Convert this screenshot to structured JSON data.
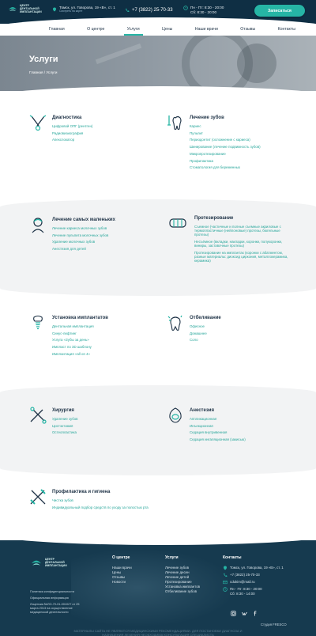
{
  "header": {
    "logo_lines": [
      "ЦЕНТР",
      "ДЕНТАЛЬНОЙ",
      "ИМПЛАНТАЦИИ"
    ],
    "address": "Томск, ул. Говорова, 19 «В», ст. 1",
    "address_link": "Смотреть на карте",
    "phone": "+7 (3822) 25-70-33",
    "hours_weekdays": "Пн - Пт: 8:30 - 20:00",
    "hours_saturday": "Сб: 8:30 - 20:00",
    "signup_label": "Записаться"
  },
  "nav": [
    "Главная",
    "О центре",
    "Услуги",
    "Цены",
    "Наши врачи",
    "Отзывы",
    "Контакты"
  ],
  "hero": {
    "title": "Услуги",
    "breadcrumb": "Главная / Услуги"
  },
  "categories": [
    {
      "title": "Диагностика",
      "icon": "dental-tools-icon",
      "items": [
        "Цифровой ОПГ (рентген)",
        "Радиовизиография",
        "Апекслокатор"
      ]
    },
    {
      "title": "Лечение зубов",
      "icon": "tooth-drill-icon",
      "items": [
        "Кариес",
        "Пульпит",
        "Периодонтит (осложнение с кариеса)",
        "Шинирование (лечение подвижность зубов)",
        "Микропротезирование",
        "Профилактика",
        "Стоматология для беременных"
      ]
    },
    {
      "title": "Лечение самых маленьких",
      "icon": "child-icon",
      "items": [
        "Лечение кариеса молочных зубов",
        "Лечение пульпита молочных зубов",
        "Удаление молочных зубов",
        "Анестезия для детей"
      ]
    },
    {
      "title": "Протезирование",
      "icon": "dentures-icon",
      "items": [
        "Съемное (частичные и полные съемные акриловые с термопластичные (нейлоновые) протезы, бюгельные протезы)",
        "Несъёмное (вкладки, накладки, коронки, полукоронки, виниры, заставочные протезы)",
        "Протезирование на имплантах (коронки с абатментом, разные материалы: диоксид циркония, металлокерамика, керамика)"
      ]
    },
    {
      "title": "Установка имплантатов",
      "icon": "implant-icon",
      "items": [
        "Дентальная имплантация",
        "Синус-лифтинг",
        "Услуга «Зубы за день»",
        "Импласт по 3D шаблону",
        "Имплантация «all on 4»"
      ]
    },
    {
      "title": "Отбеливание",
      "icon": "whitening-tooth-icon",
      "items": [
        "Офисное",
        "Домашнее",
        "Соло"
      ]
    },
    {
      "title": "Хирургия",
      "icon": "surgery-tools-icon",
      "items": [
        "Удаление зубов",
        "Цистэктомия",
        "Остеопластика"
      ]
    },
    {
      "title": "Анестезия",
      "icon": "anesthesia-mask-icon",
      "items": [
        "Аппликационная",
        "Инъекционная",
        "Седация внутривенная",
        "Седация ингаляционная (закисью)"
      ]
    },
    {
      "title": "Профилактика и гигиена",
      "icon": "toothbrush-icon",
      "items": [
        "Чистка зубов",
        "Индивидуальный подбор средств по уходу за полостью рта"
      ]
    }
  ],
  "footer": {
    "logo_lines": [
      "ЦЕНТР",
      "ДЕНТАЛЬНОЙ",
      "ИМПЛАНТАЦИИ"
    ],
    "links": [
      "Политика конфиденциальности",
      "Официальная информация",
      "Лицензия №ЛО-70-01-001027 от 25 марта 2013 на осуществление медицинской деятельности"
    ],
    "col1_title": "О центре",
    "col1_items": [
      "Наши врачи",
      "Цены",
      "Отзывы",
      "Новости"
    ],
    "col2_title": "Услуги",
    "col2_items": [
      "Лечение зубов",
      "Лечение десен",
      "Лечение детей",
      "Протезирование",
      "Установка имплантов",
      "Отбеливание зубов"
    ],
    "contacts_title": "Контакты",
    "address": "Томск, ул. Говорова, 19 «В», ст. 1",
    "phone": "+7 (3822) 25-70-33",
    "email": "cdukim@mail.ru",
    "hours1": "Пн - Пт: 8:30 - 20:00",
    "hours2": "Сб: 8:30 - 14:00",
    "studio": "Студия FRESCO",
    "copyright": "МАТЕРИАЛЫ САЙТА НЕ ЯВЛЯЮТСЯ МЕДИЦИНСКИМИ РЕКОМЕНДАЦИЯМИ. ДЛЯ ПОСТАНОВКИ ДИАГНОЗА И НАЗНАЧЕНИЯ ЛЕЧЕНИЯ НЕОБХОДИМА КОНСУЛЬТАЦИЯ СПЕЦИАЛИСТА"
  },
  "colors": {
    "accent": "#26b5a5",
    "dark": "#0f2f44",
    "link": "#26a69a"
  }
}
